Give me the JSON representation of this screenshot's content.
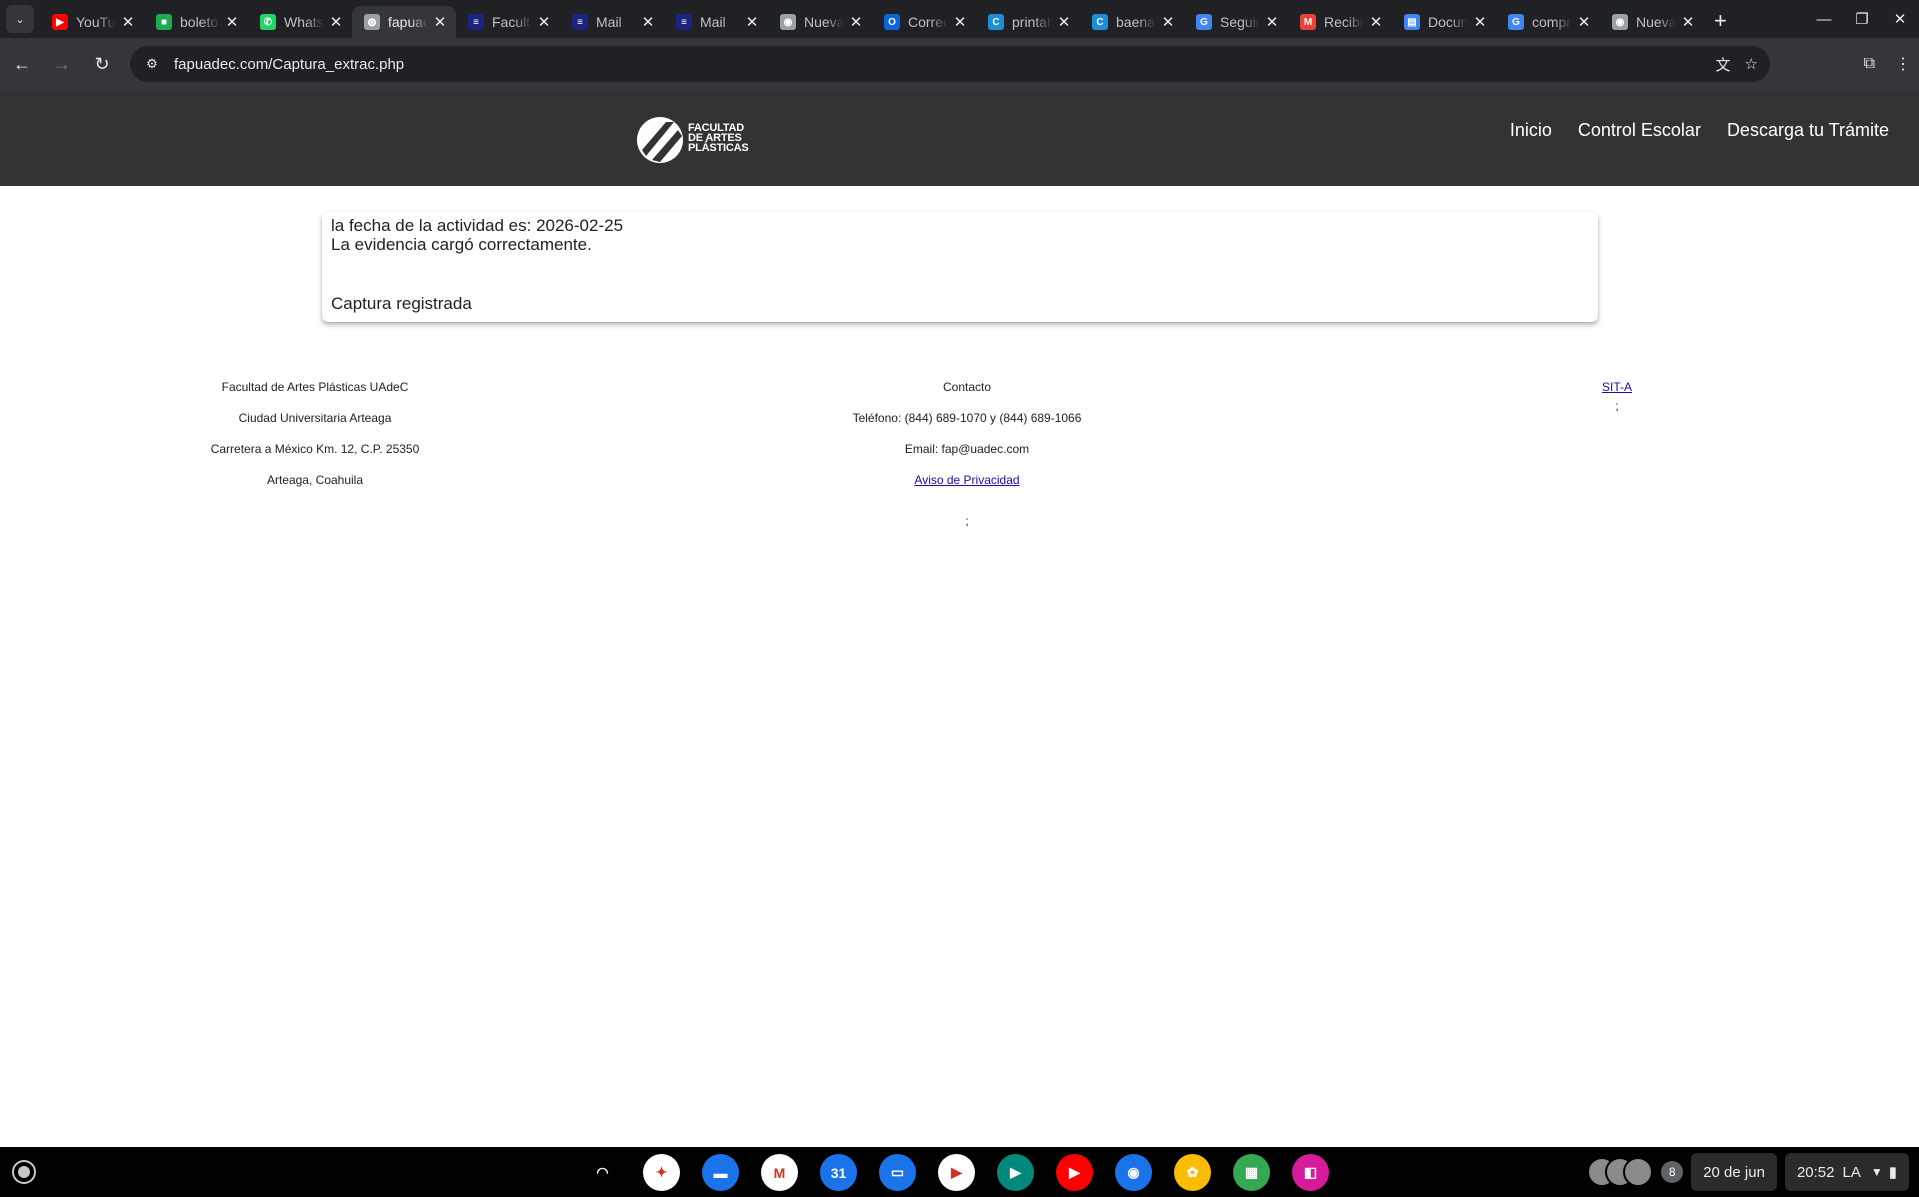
{
  "browser": {
    "tabs": [
      {
        "title": "YouTube",
        "icon": "youtube-icon",
        "color": "#ff0000",
        "glyph": "▶",
        "active": false
      },
      {
        "title": "boleto",
        "icon": "ticket-icon",
        "color": "#1eaa4f",
        "glyph": "■",
        "active": false
      },
      {
        "title": "WhatsApp",
        "icon": "whatsapp-icon",
        "color": "#25d366",
        "glyph": "✆",
        "active": false
      },
      {
        "title": "fapuadec",
        "icon": "globe-icon",
        "color": "#9aa0a6",
        "glyph": "◍",
        "active": true
      },
      {
        "title": "Facultad",
        "icon": "site-icon",
        "color": "#1a237e",
        "glyph": "≡",
        "active": false
      },
      {
        "title": "Mail",
        "icon": "mail-site-icon",
        "color": "#1a237e",
        "glyph": "≡",
        "active": false
      },
      {
        "title": "Mail",
        "icon": "mail-site-icon",
        "color": "#1a237e",
        "glyph": "≡",
        "active": false
      },
      {
        "title": "Nueva",
        "icon": "chrome-icon",
        "color": "#9aa0a6",
        "glyph": "◉",
        "active": false
      },
      {
        "title": "Correo",
        "icon": "outlook-icon",
        "color": "#0a64d8",
        "glyph": "O",
        "active": false
      },
      {
        "title": "printable",
        "icon": "canva-icon",
        "color": "#1b8fd8",
        "glyph": "C",
        "active": false
      },
      {
        "title": "baena",
        "icon": "canva-icon",
        "color": "#1b8fd8",
        "glyph": "C",
        "active": false
      },
      {
        "title": "Seguimiento",
        "icon": "google-icon",
        "color": "#4285f4",
        "glyph": "G",
        "active": false
      },
      {
        "title": "Recibido",
        "icon": "gmail-icon",
        "color": "#ea4335",
        "glyph": "M",
        "active": false
      },
      {
        "title": "Documento",
        "icon": "docs-icon",
        "color": "#4285f4",
        "glyph": "▤",
        "active": false
      },
      {
        "title": "compra",
        "icon": "google-icon",
        "color": "#4285f4",
        "glyph": "G",
        "active": false
      },
      {
        "title": "Nueva",
        "icon": "chrome-icon",
        "color": "#9aa0a6",
        "glyph": "◉",
        "active": false
      }
    ],
    "close_glyph": "✕",
    "new_tab_glyph": "+",
    "tab_search_glyph": "⌄",
    "window_controls": {
      "minimize": "—",
      "restore": "❐",
      "close": "✕"
    },
    "nav": {
      "back": "←",
      "forward": "→",
      "reload": "↻"
    },
    "url": "fapuadec.com/Captura_extrac.php",
    "site_info_glyph": "⚙",
    "omnibox_icons": {
      "translate": "文",
      "bookmark": "☆"
    },
    "toolbar_icons": {
      "extensions": "⧉",
      "menu": "⋮"
    }
  },
  "site": {
    "logo_text": [
      "FACULTAD",
      "DE ARTES",
      "PLÁSTICAS"
    ],
    "nav": [
      "Inicio",
      "Control Escolar",
      "Descarga tu Trámite"
    ]
  },
  "message": {
    "line1": "la fecha de la actividad es: 2026-02-25",
    "line2": "La evidencia cargó correctamente.",
    "line3": "Captura registrada"
  },
  "footer": {
    "col1": [
      "Facultad de Artes Plásticas UAdeC",
      "Ciudad Universitaria Arteaga",
      "Carretera a México Km. 12, C.P. 25350",
      "Arteaga, Coahuila"
    ],
    "col2": {
      "heading": "Contacto",
      "phone": "Teléfono: (844) 689-1070 y (844) 689-1066",
      "email": "Email: fap@uadec.com",
      "privacy_link": "Aviso de Privacidad",
      "trailing": ";"
    },
    "col3": {
      "link": "SIT-A",
      "trailing": ";"
    }
  },
  "shelf": {
    "apps": [
      {
        "name": "cast-icon",
        "color": "#000000",
        "glyph": "◠"
      },
      {
        "name": "gemini-icon",
        "color": "#ffffff",
        "glyph": "✦"
      },
      {
        "name": "files-icon",
        "color": "#1a73e8",
        "glyph": "▬"
      },
      {
        "name": "gmail-icon",
        "color": "#ffffff",
        "glyph": "M"
      },
      {
        "name": "calendar-icon",
        "color": "#1a73e8",
        "glyph": "31"
      },
      {
        "name": "messages-icon",
        "color": "#1a73e8",
        "glyph": "▭"
      },
      {
        "name": "play-store-icon",
        "color": "#ffffff",
        "glyph": "▶"
      },
      {
        "name": "meet-icon",
        "color": "#00897b",
        "glyph": "▶"
      },
      {
        "name": "youtube-icon",
        "color": "#ff0000",
        "glyph": "▶"
      },
      {
        "name": "chrome-icon",
        "color": "#1a73e8",
        "glyph": "◉"
      },
      {
        "name": "photos-icon",
        "color": "#fbbc04",
        "glyph": "✿"
      },
      {
        "name": "apps-icon",
        "color": "#34a853",
        "glyph": "▦"
      },
      {
        "name": "screenshot-icon",
        "color": "#d81b9a",
        "glyph": "◧"
      }
    ],
    "notification_count": "8",
    "date": "20 de jun",
    "time": "20:52",
    "locale": "LA",
    "wifi_glyph": "▼",
    "battery_glyph": "▮"
  }
}
